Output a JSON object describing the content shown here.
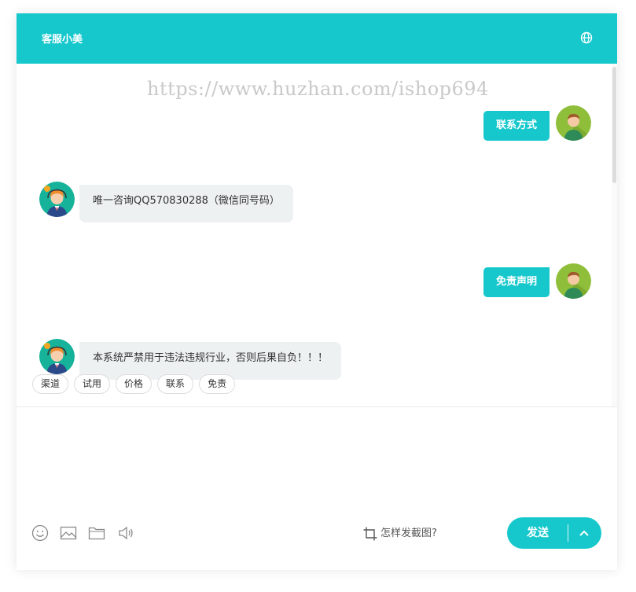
{
  "header": {
    "title": "客服小美",
    "language_icon": "globe-icon"
  },
  "watermark": "https://www.huzhan.com/ishop694",
  "messages": [
    {
      "side": "right",
      "text": "联系方式",
      "avatar": "user-avatar"
    },
    {
      "side": "left",
      "text": "唯一咨询QQ570830288（微信同号码）",
      "avatar": "agent-avatar"
    },
    {
      "side": "right",
      "text": "免责声明",
      "avatar": "user-avatar"
    },
    {
      "side": "left",
      "text": "本系统严禁用于违法违规行业，否则后果自负！！！",
      "avatar": "agent-avatar"
    }
  ],
  "quick_replies": [
    "渠道",
    "试用",
    "价格",
    "联系",
    "免责"
  ],
  "composer": {
    "input_value": "",
    "tools": [
      "emoji-icon",
      "image-icon",
      "folder-icon",
      "speaker-icon"
    ],
    "screenshot_hint": "怎样发截图?",
    "send_label": "发送"
  },
  "colors": {
    "accent": "#16c8cc",
    "bubble_left": "#edf1f2"
  }
}
